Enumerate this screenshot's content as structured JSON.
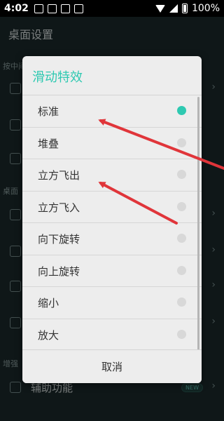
{
  "status_bar": {
    "time": "4:02",
    "battery": "100%"
  },
  "background": {
    "title": "桌面设置",
    "section_1": "按中间",
    "section_2": "桌面",
    "section_3": "增强",
    "assist_label": "辅助功能",
    "new_badge": "NEW"
  },
  "dialog": {
    "title": "滑动特效",
    "options": [
      {
        "label": "标准",
        "selected": true
      },
      {
        "label": "堆叠",
        "selected": false
      },
      {
        "label": "立方飞出",
        "selected": false
      },
      {
        "label": "立方飞入",
        "selected": false
      },
      {
        "label": "向下旋转",
        "selected": false
      },
      {
        "label": "向上旋转",
        "selected": false
      },
      {
        "label": "缩小",
        "selected": false
      },
      {
        "label": "放大",
        "selected": false
      }
    ],
    "cancel_label": "取消"
  },
  "colors": {
    "accent": "#2ec9b1",
    "annotation": "#e0353a",
    "dialog_bg": "#ededed"
  }
}
